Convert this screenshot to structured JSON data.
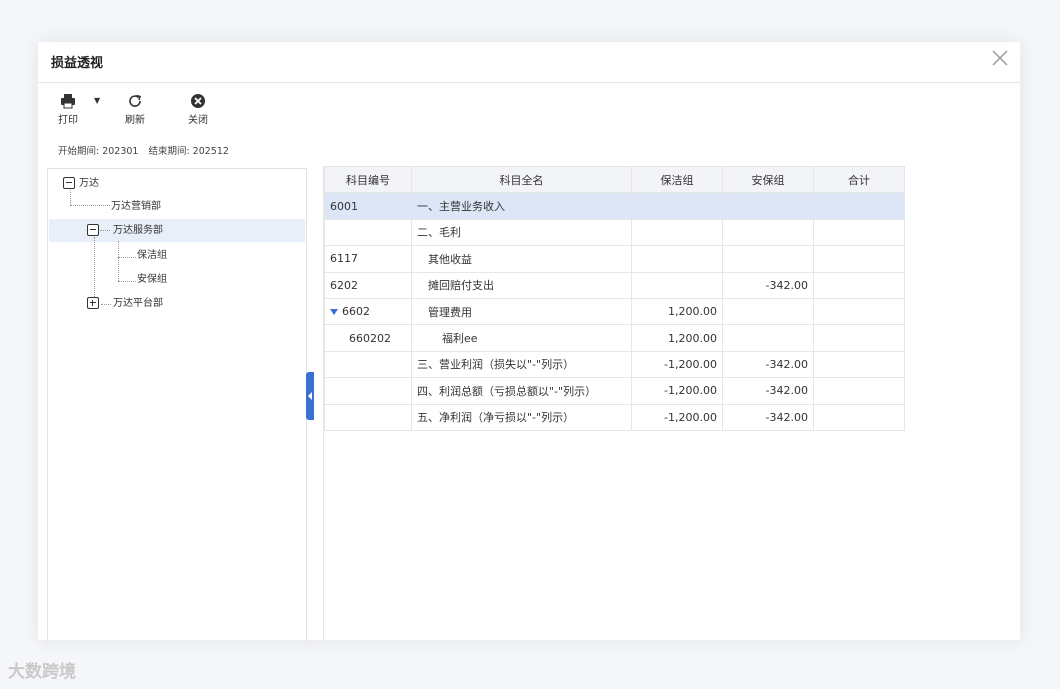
{
  "dialog": {
    "title": "损益透视"
  },
  "toolbar": {
    "print": "打印",
    "refresh": "刷新",
    "close": "关闭"
  },
  "period": {
    "start_label": "开始期间:",
    "start_value": "202301",
    "end_label": "结束期间:",
    "end_value": "202512"
  },
  "tree": {
    "root": "万达",
    "n1": "万达营销部",
    "n2": "万达服务部",
    "n2a": "保洁组",
    "n2b": "安保组",
    "n3": "万达平台部"
  },
  "grid": {
    "headers": [
      "科目编号",
      "科目全名",
      "保洁组",
      "安保组",
      "合计"
    ],
    "rows": [
      [
        "6001",
        "一、主营业务收入",
        "",
        "",
        ""
      ],
      [
        "",
        "二、毛利",
        "",
        "",
        ""
      ],
      [
        "6117",
        "其他收益",
        "",
        "",
        ""
      ],
      [
        "6202",
        "摊回赔付支出",
        "",
        "-342.00",
        ""
      ],
      [
        "6602",
        "管理费用",
        "1,200.00",
        "",
        ""
      ],
      [
        "660202",
        "福利ee",
        "1,200.00",
        "",
        ""
      ],
      [
        "",
        "三、营业利润（损失以\"-\"列示）",
        "-1,200.00",
        "-342.00",
        ""
      ],
      [
        "",
        "四、利润总额（亏损总额以\"-\"列示）",
        "-1,200.00",
        "-342.00",
        ""
      ],
      [
        "",
        "五、净利润（净亏损以\"-\"列示）",
        "-1,200.00",
        "-342.00",
        ""
      ]
    ]
  },
  "watermark": "大数跨境",
  "colors": {
    "accent": "#3b6fd0",
    "selected_row": "#dce6f7"
  }
}
